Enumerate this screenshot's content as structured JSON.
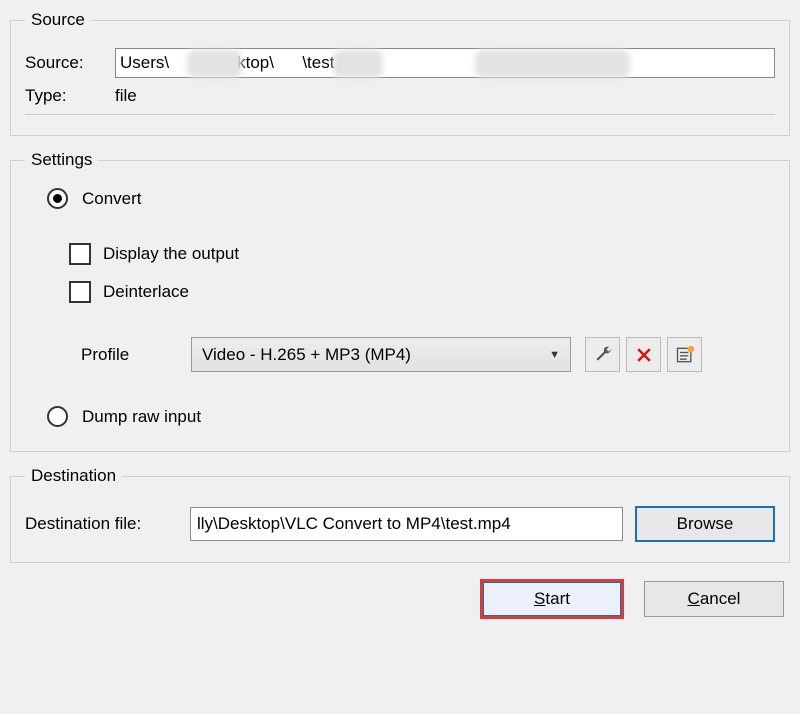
{
  "source": {
    "legend": "Source",
    "source_label": "Source:",
    "source_value": "Users\\       \\Desktop\\      \\test files\\                       \\0028WQ03.mkv",
    "type_label": "Type:",
    "type_value": "file"
  },
  "settings": {
    "legend": "Settings",
    "convert_label": "Convert",
    "display_output_label": "Display the output",
    "deinterlace_label": "Deinterlace",
    "profile_label": "Profile",
    "profile_selected": "Video - H.265 + MP3 (MP4)",
    "dump_raw_label": "Dump raw input"
  },
  "destination": {
    "legend": "Destination",
    "dest_label": "Destination file:",
    "dest_value": "lly\\Desktop\\VLC Convert to MP4\\test.mp4",
    "browse_label": "Browse"
  },
  "buttons": {
    "start": "Start",
    "cancel": "Cancel"
  }
}
